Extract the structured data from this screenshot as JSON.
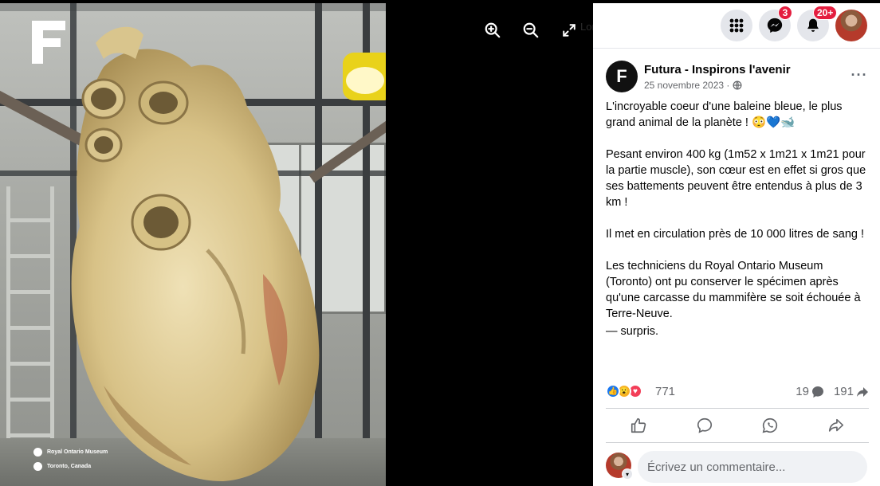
{
  "viewer": {
    "photo_caption_place": "Royal Ontario Museum",
    "photo_caption_location": "Toronto, Canada",
    "ghost_search_text": "Lorem Protacyae"
  },
  "topbar": {
    "messenger_badge": "3",
    "notifications_badge": "20+"
  },
  "post": {
    "page_name": "Futura - Inspirons l'avenir",
    "page_initial": "F",
    "date": "25 novembre 2023 ·",
    "paragraphs": [
      "L'incroyable coeur d'une baleine bleue, le plus grand animal de la planète ! 😳💙🐋",
      "Pesant environ 400 kg (1m52 x 1m21 x 1m21 pour la partie muscle), son cœur est en effet si gros que ses battements peuvent être entendus à plus de 3 km !",
      "Il met en circulation près de 10 000 litres de sang !",
      "Les techniciens du Royal Ontario Museum (Toronto) ont pu conserver le spécimen après qu'une carcasse du mammifère se soit échouée à Terre-Neuve.",
      "— surpris."
    ],
    "reaction_count": "771",
    "comment_count": "19",
    "share_count": "191"
  },
  "comment_box": {
    "placeholder": "Écrivez un commentaire..."
  },
  "colors": {
    "badge": "#e41e3f",
    "like_blue": "#1877f2",
    "love_red": "#f33e58",
    "wow_yellow": "#f7b125"
  }
}
